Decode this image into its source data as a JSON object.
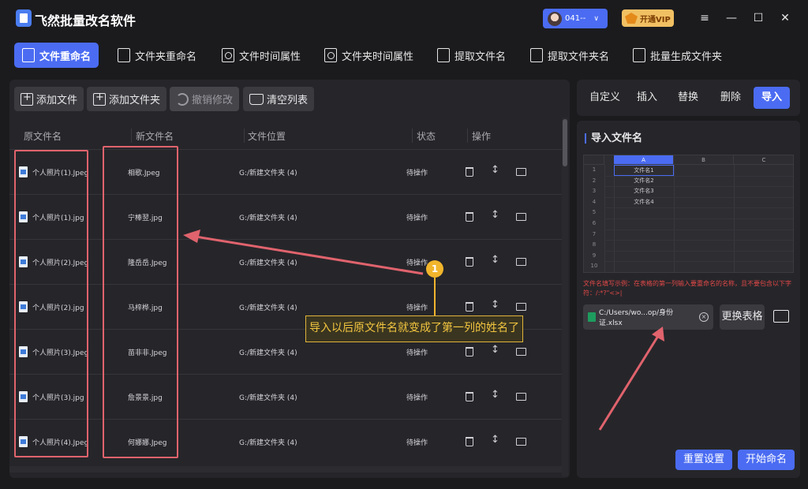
{
  "app": {
    "title": "飞然批量改名软件",
    "user_name": "041--",
    "vip_label": "开通VIP"
  },
  "window_controls": {
    "menu": "≡",
    "minimize": "—",
    "maximize": "☐",
    "close": "✕"
  },
  "tabs": [
    {
      "label": "文件重命名",
      "active": true
    },
    {
      "label": "文件夹重命名"
    },
    {
      "label": "文件时间属性"
    },
    {
      "label": "文件夹时间属性"
    },
    {
      "label": "提取文件名"
    },
    {
      "label": "提取文件夹名"
    },
    {
      "label": "批量生成文件夹"
    }
  ],
  "toolbar": {
    "add_file": "添加文件",
    "add_folder": "添加文件夹",
    "undo": "撤销修改",
    "clear": "清空列表"
  },
  "table": {
    "headers": {
      "original": "原文件名",
      "new": "新文件名",
      "location": "文件位置",
      "status": "状态",
      "actions": "操作"
    },
    "rows": [
      {
        "original": "个人照片(1).Jpeg",
        "new": "相歌.Jpeg",
        "location": "G:/新建文件夹 (4)",
        "status": "待操作"
      },
      {
        "original": "个人照片(1).jpg",
        "new": "宁棒翌.jpg",
        "location": "G:/新建文件夹 (4)",
        "status": "待操作"
      },
      {
        "original": "个人照片(2).Jpeg",
        "new": "隆岳岳.Jpeg",
        "location": "G:/新建文件夹 (4)",
        "status": "待操作"
      },
      {
        "original": "个人照片(2).jpg",
        "new": "马梓桦.jpg",
        "location": "G:/新建文件夹 (4)",
        "status": "待操作"
      },
      {
        "original": "个人照片(3).Jpeg",
        "new": "苗非非.Jpeg",
        "location": "G:/新建文件夹 (4)",
        "status": "待操作"
      },
      {
        "original": "个人照片(3).jpg",
        "new": "詹景景.jpg",
        "location": "G:/新建文件夹 (4)",
        "status": "待操作"
      },
      {
        "original": "个人照片(4).Jpeg",
        "new": "何娜娜.Jpeg",
        "location": "G:/新建文件夹 (4)",
        "status": "待操作"
      }
    ]
  },
  "right_tabs": [
    {
      "label": "自定义"
    },
    {
      "label": "插入"
    },
    {
      "label": "替换"
    },
    {
      "label": "删除"
    },
    {
      "label": "导入",
      "active": true
    }
  ],
  "import": {
    "section_title": "导入文件名",
    "sheet_columns": [
      "A",
      "B",
      "C"
    ],
    "sheet_row_numbers": [
      "1",
      "2",
      "3",
      "4",
      "5",
      "6",
      "7",
      "8",
      "9",
      "10"
    ],
    "sheet_values": [
      "文件名1",
      "文件名2",
      "文件名3",
      "文件名4"
    ],
    "hint": "文件名填写示例：在表格的第一列输入要重命名的名称，且不要包含以下字符：/:*?\"<>|",
    "file_path": "C:/Users/wo...op/身份证.xlsx",
    "swap_label": "更换表格",
    "reset_label": "重置设置",
    "start_label": "开始命名"
  },
  "annotation": {
    "badge": "1",
    "text": "导入以后原文件名就变成了第一列的姓名了"
  },
  "colors": {
    "accent": "#4b6cf2",
    "highlight_box": "#e0636d",
    "callout": "#f3c640",
    "hint": "#e04848"
  }
}
